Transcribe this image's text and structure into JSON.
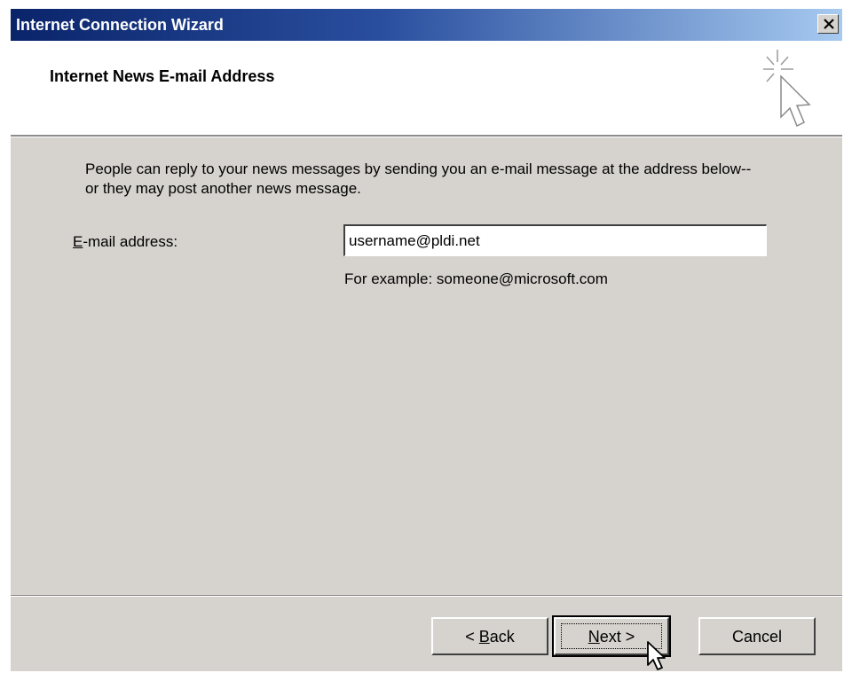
{
  "window": {
    "title": "Internet Connection Wizard",
    "close_icon": "close-icon"
  },
  "header": {
    "title": "Internet News E-mail Address",
    "icon": "wizard-sparkle-cursor-icon"
  },
  "body": {
    "description": "People can reply to your news messages by sending you an e-mail message at the address below--or they may post another news message.",
    "email_label_mnemonic": "E",
    "email_label_rest": "-mail address:",
    "email_value": "username@pldi.net",
    "example": "For example: someone@microsoft.com"
  },
  "buttons": {
    "back_prefix": "< ",
    "back_mnemonic": "B",
    "back_rest": "ack",
    "next_mnemonic": "N",
    "next_rest": "ext >",
    "cancel": "Cancel"
  },
  "cursor": "mouse-pointer-icon"
}
